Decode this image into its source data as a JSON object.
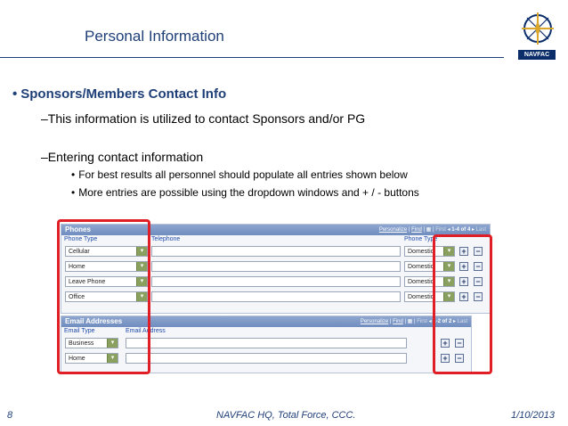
{
  "slide": {
    "title": "Personal Information",
    "logo_text": "NAVFAC",
    "bullet_main": "Sponsors/Members Contact Info",
    "sub1": "–This information is utilized to contact Sponsors and/or PG",
    "sub2": "–Entering contact information",
    "sub3": "For best results all personnel should populate all entries shown below",
    "sub4": "More entries are possible using the dropdown windows and + / - buttons",
    "bullet_glyph": "•"
  },
  "phones": {
    "header": "Phones",
    "nav": {
      "personalize": "Personalize",
      "find": "Find",
      "first": "First",
      "range": "1-4 of 4",
      "last": "Last"
    },
    "columns": {
      "phone_type": "Phone Type",
      "telephone": "Telephone",
      "phone_type2": "Phone Type"
    },
    "rows": [
      {
        "type": "Cellular",
        "location": "Domestic"
      },
      {
        "type": "Home",
        "location": "Domestic"
      },
      {
        "type": "Leave Phone",
        "location": "Domestic"
      },
      {
        "type": "Office",
        "location": "Domestic"
      }
    ]
  },
  "email": {
    "header": "Email Addresses",
    "nav": {
      "personalize": "Personalize",
      "find": "Find",
      "first": "First",
      "range": "1-2 of 2",
      "last": "Last"
    },
    "columns": {
      "email_type": "Email Type",
      "email_address": "Email Address"
    },
    "rows": [
      {
        "type": "Business"
      },
      {
        "type": "Home"
      }
    ]
  },
  "buttons": {
    "add": "+",
    "remove": "−",
    "dropdown": "▾"
  },
  "footer": {
    "page": "8",
    "center": "NAVFAC HQ, Total Force, CCC.",
    "date": "1/10/2013"
  },
  "colors": {
    "highlight": "#e01e25",
    "title": "#1f3f78"
  }
}
